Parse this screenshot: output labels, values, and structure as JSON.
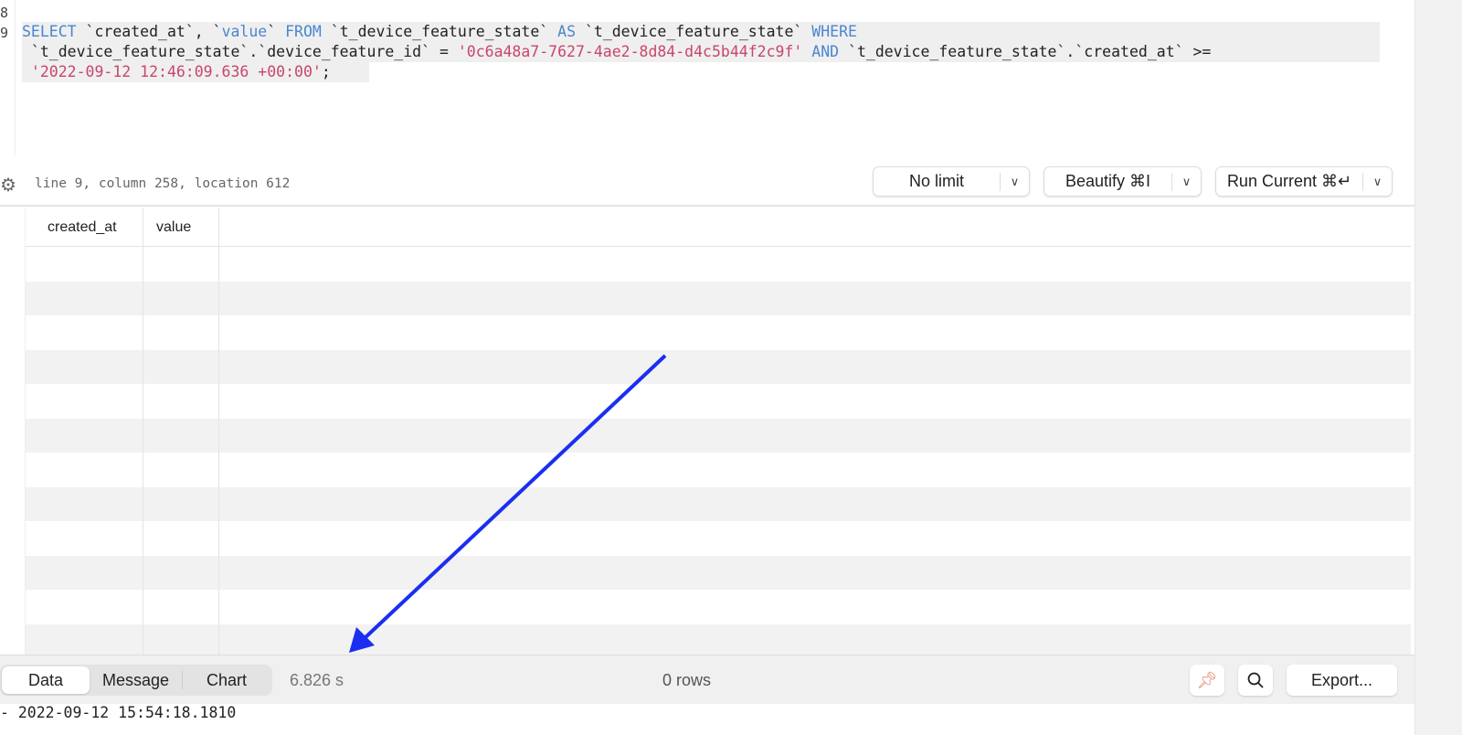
{
  "editor": {
    "line_numbers": [
      "8",
      "9"
    ],
    "sql": {
      "l1": [
        [
          "kw",
          "SELECT"
        ],
        [
          "t",
          " `created_at`, `"
        ],
        [
          "kw",
          "value"
        ],
        [
          "t",
          "` "
        ],
        [
          "kw",
          "FROM"
        ],
        [
          "t",
          " `t_device_feature_state` "
        ],
        [
          "kw",
          "AS"
        ],
        [
          "t",
          " `t_device_feature_state` "
        ],
        [
          "kw",
          "WHERE"
        ]
      ],
      "l2": [
        [
          "t",
          " `t_device_feature_state`.`device_feature_id` = "
        ],
        [
          "str",
          "'0c6a48a7-7627-4ae2-8d84-d4c5b44f2c9f'"
        ],
        [
          "t",
          " "
        ],
        [
          "kw",
          "AND"
        ],
        [
          "t",
          " `t_device_feature_state`.`created_at` >="
        ]
      ],
      "l3": [
        [
          "str",
          " '2022-09-12 12:46:09.636 +00:00'"
        ],
        [
          "t",
          ";"
        ]
      ]
    }
  },
  "status": {
    "cursor_position": "line 9, column 258, location 612",
    "limit_label": "No limit",
    "beautify_label": "Beautify ⌘I",
    "run_label": "Run Current ⌘↵"
  },
  "grid": {
    "columns": [
      "created_at",
      "value"
    ],
    "rows": []
  },
  "bottom": {
    "tabs": [
      "Data",
      "Message",
      "Chart"
    ],
    "active_tab": "Data",
    "elapsed": "6.826 s",
    "row_count": "0 rows",
    "export_label": "Export..."
  },
  "log_line": "- 2022-09-12 15:54:18.1810",
  "colors": {
    "keyword": "#4a86d0",
    "string": "#c8466b",
    "annotation_arrow": "#1a2ff0",
    "pin": "#e5876a"
  }
}
